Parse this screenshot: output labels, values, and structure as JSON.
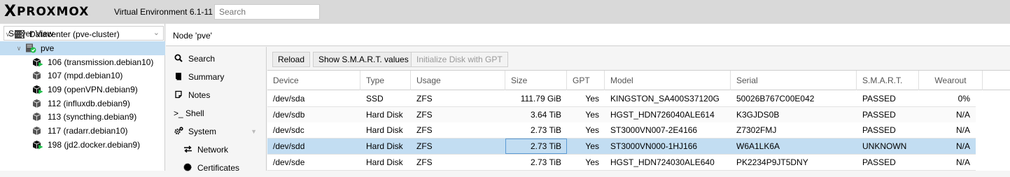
{
  "header": {
    "logo_x": "X",
    "logo_text": "PROXMOX",
    "version": "Virtual Environment 6.1-11",
    "search_placeholder": "Search"
  },
  "sidebar": {
    "view_select": "Server View",
    "tree": [
      {
        "label": "Datacenter (pve-cluster)",
        "icon": "datacenter-icon",
        "level": 0
      },
      {
        "label": "pve",
        "icon": "node-online-icon",
        "level": 1,
        "selected": true
      },
      {
        "label": "106 (transmission.debian10)",
        "icon": "container-running-icon",
        "level": 2
      },
      {
        "label": "107 (mpd.debian10)",
        "icon": "container-stopped-icon",
        "level": 2
      },
      {
        "label": "109 (openVPN.debian9)",
        "icon": "container-running-icon",
        "level": 2
      },
      {
        "label": "112 (influxdb.debian9)",
        "icon": "container-stopped-icon",
        "level": 2
      },
      {
        "label": "113 (syncthing.debian9)",
        "icon": "container-stopped-icon",
        "level": 2
      },
      {
        "label": "117 (radarr.debian10)",
        "icon": "container-stopped-icon",
        "level": 2
      },
      {
        "label": "198 (jd2.docker.debian9)",
        "icon": "container-running-icon",
        "level": 2
      }
    ]
  },
  "content": {
    "title": "Node 'pve'"
  },
  "menu": [
    {
      "label": "Search",
      "icon": "search-icon"
    },
    {
      "label": "Summary",
      "icon": "book-icon"
    },
    {
      "label": "Notes",
      "icon": "notes-icon"
    },
    {
      "label": ">_ Shell",
      "icon": "terminal-icon"
    },
    {
      "label": "System",
      "icon": "gears-icon"
    },
    {
      "label": "Network",
      "icon": "exchange-icon"
    },
    {
      "label": "Certificates",
      "icon": "certificate-icon"
    }
  ],
  "toolbar": {
    "reload": "Reload",
    "smart": "Show S.M.A.R.T. values",
    "init_gpt": "Initialize Disk with GPT"
  },
  "disks": {
    "columns": [
      "Device",
      "Type",
      "Usage",
      "Size",
      "GPT",
      "Model",
      "Serial",
      "S.M.A.R.T.",
      "Wearout"
    ],
    "rows": [
      [
        "/dev/sda",
        "SSD",
        "ZFS",
        "111.79 GiB",
        "Yes",
        "KINGSTON_SA400S37120G",
        "50026B767C00E042",
        "PASSED",
        "0%"
      ],
      [
        "/dev/sdb",
        "Hard Disk",
        "ZFS",
        "3.64 TiB",
        "Yes",
        "HGST_HDN726040ALE614",
        "K3GJDS0B",
        "PASSED",
        "N/A"
      ],
      [
        "/dev/sdc",
        "Hard Disk",
        "ZFS",
        "2.73 TiB",
        "Yes",
        "ST3000VN007-2E4166",
        "Z7302FMJ",
        "PASSED",
        "N/A"
      ],
      [
        "/dev/sdd",
        "Hard Disk",
        "ZFS",
        "2.73 TiB",
        "Yes",
        "ST3000VN000-1HJ166",
        "W6A1LK6A",
        "UNKNOWN",
        "N/A"
      ],
      [
        "/dev/sde",
        "Hard Disk",
        "ZFS",
        "2.73 TiB",
        "Yes",
        "HGST_HDN724030ALE640",
        "PK2234P9JT5DNY",
        "PASSED",
        "N/A"
      ]
    ],
    "selected_row": 3
  },
  "colors": {
    "selection": "#c2ddf2",
    "running": "#21bf4b",
    "topbar": "#d9d9d9"
  }
}
